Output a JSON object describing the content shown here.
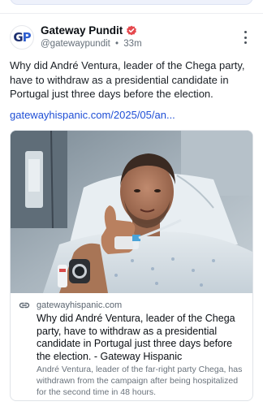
{
  "post": {
    "author": {
      "display_name": "Gateway Pundit",
      "handle": "@gatewaypundit",
      "separator": "•",
      "timestamp": "33m",
      "avatar_text_g": "G",
      "avatar_text_p": "P",
      "verified_icon": "verified-badge-icon",
      "verified_color": "#e5484d"
    },
    "text": "Why did André Ventura, leader of the Chega party, have to withdraw as a presidential candidate in Portugal just three days before the election.",
    "link": "gatewayhispanic.com/2025/05/an...",
    "card": {
      "domain": "gatewayhispanic.com",
      "title": "Why did André Ventura, leader of the Chega party, have to withdraw as a presidential candidate in Portugal just three days before the election. - Gateway Hispanic",
      "description": "André Ventura, leader of the far-right party Chega, has withdrawn from the campaign after being hospitalized for the second time in 48 hours.",
      "image_alt": "man-in-hospital-bed-thumbs-up-photo"
    }
  },
  "colors": {
    "link": "#1f4fd6",
    "muted": "#66707a",
    "brand_dark": "#1d2f6f",
    "brand_blue": "#2f5fd0"
  }
}
